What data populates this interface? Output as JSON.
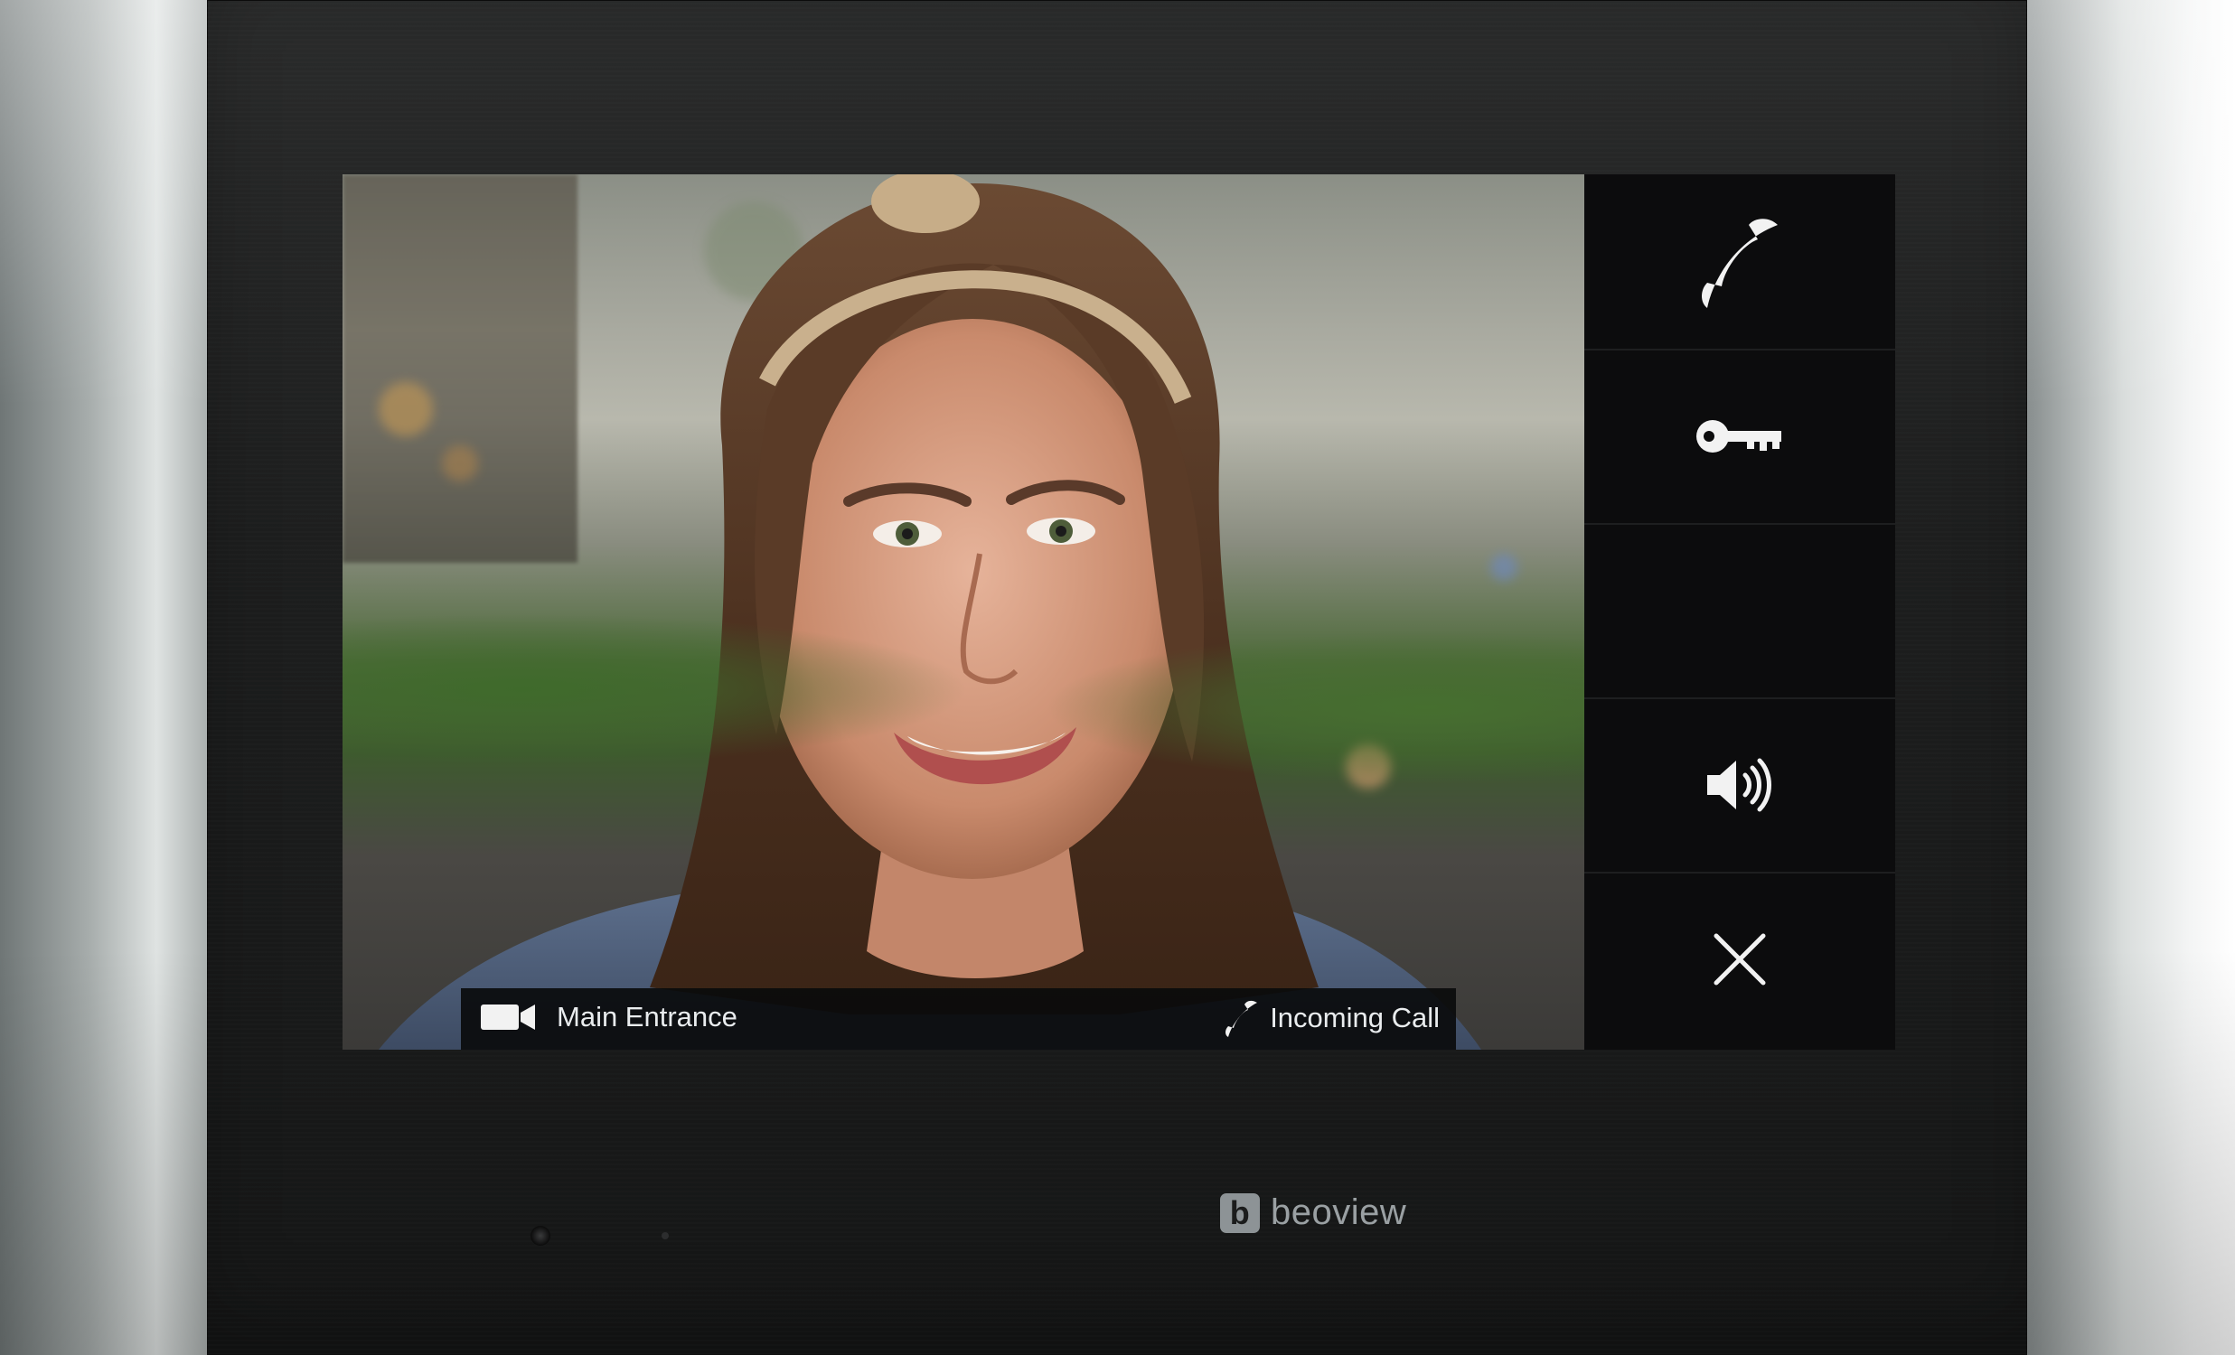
{
  "device": {
    "brand_logo_letter": "b",
    "brand_name": "beoview"
  },
  "video_feed": {
    "camera_label": "Main Entrance",
    "call_status": "Incoming Call"
  },
  "sidebar": {
    "buttons": [
      {
        "icon": "phone-handset-icon",
        "action": "answer"
      },
      {
        "icon": "key-icon",
        "action": "unlock-door"
      },
      {
        "icon": "",
        "action": "empty"
      },
      {
        "icon": "speaker-volume-icon",
        "action": "volume"
      },
      {
        "icon": "close-icon",
        "action": "end-call"
      }
    ]
  },
  "colors": {
    "panel": "#1d1e1e",
    "sidebar": "#0c0c0d",
    "icon": "#f2f2f2",
    "brand_text": "#9aa0a3"
  }
}
